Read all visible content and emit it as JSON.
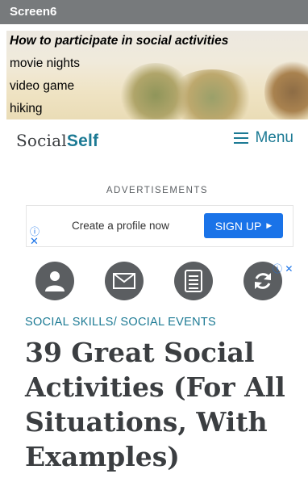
{
  "app": {
    "title": "Screen6"
  },
  "hero": {
    "heading": "How to participate in social activities",
    "lines": [
      "movie nights",
      "video game",
      "hiking"
    ]
  },
  "site": {
    "logo_part1": "Social",
    "logo_part2": "Self",
    "menu_label": "Menu"
  },
  "ads": {
    "label": "ADVERTISEMENTS",
    "text": "Create a profile now",
    "button": "SIGN UP",
    "info_glyph": "ⓘ",
    "close_glyph": "✕",
    "mini": "ⓘ ✕"
  },
  "share_icons": [
    "user-icon",
    "mail-icon",
    "document-icon",
    "refresh-icon"
  ],
  "article": {
    "categories": "SOCIAL SKILLS/ SOCIAL EVENTS",
    "title": "39 Great Social Activities (For All Situations, With Examples)"
  },
  "colors": {
    "accent": "#1c7a94",
    "ad_blue": "#1a73e8",
    "titlebar": "#777a7c"
  }
}
